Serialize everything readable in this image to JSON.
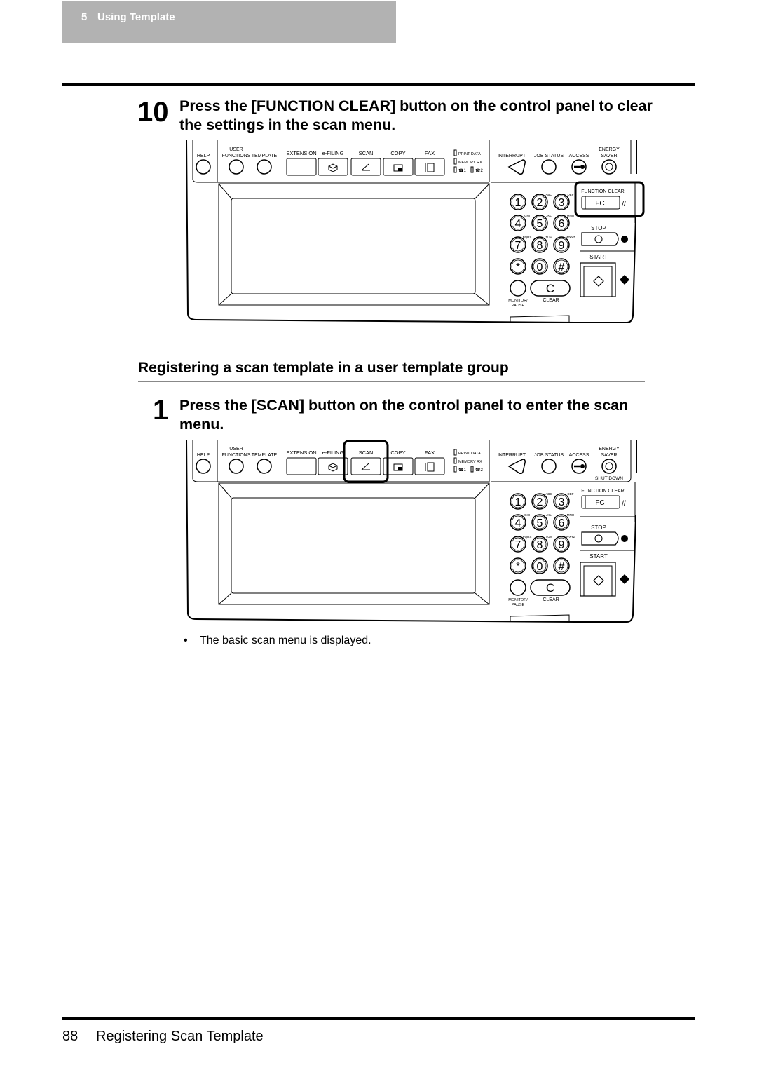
{
  "header": {
    "chapter_number": "5",
    "chapter_title": "Using Template"
  },
  "step10": {
    "number": "10",
    "line1": "Press the [FUNCTION CLEAR] button on the control panel to clear",
    "line2": "the settings in the scan menu."
  },
  "section": {
    "heading": "Registering a scan template in a user template group"
  },
  "step1": {
    "number": "1",
    "line1": "Press the [SCAN] button on the control panel to enter the scan",
    "line2": "menu.",
    "bullet": "The basic scan menu is displayed."
  },
  "panel": {
    "help": "HELP",
    "user_functions_1": "USER",
    "user_functions_2": "FUNCTIONS",
    "template": "TEMPLATE",
    "extension": "EXTENSION",
    "efiling": "e-FILING",
    "scan": "SCAN",
    "copy": "COPY",
    "fax": "FAX",
    "print_data": "PRINT DATA",
    "memory_rx": "MEMORY RX",
    "line1": "1",
    "line2": "2",
    "interrupt": "INTERRUPT",
    "job_status": "JOB STATUS",
    "access": "ACCESS",
    "energy_1": "ENERGY",
    "energy_2": "SAVER",
    "shut_down": "SHUT DOWN",
    "function_clear": "FUNCTION CLEAR",
    "fc": "FC",
    "stop": "STOP",
    "start": "START",
    "monitor_1": "MONITOR/",
    "monitor_2": "PAUSE",
    "clear": "CLEAR",
    "keys": [
      "1",
      "2",
      "3",
      "4",
      "5",
      "6",
      "7",
      "8",
      "9",
      "*",
      "0",
      "#"
    ],
    "key_letters": [
      "",
      "ABC",
      "DEF",
      "GHI",
      "JKL",
      "MNO",
      "PQRS",
      "TUV",
      "WXYZ",
      "",
      "",
      ""
    ]
  },
  "panel1_highlight": "FUNCTION CLEAR",
  "panel2_highlight": "SCAN",
  "footer": {
    "page_number": "88",
    "title": "Registering Scan Template"
  }
}
